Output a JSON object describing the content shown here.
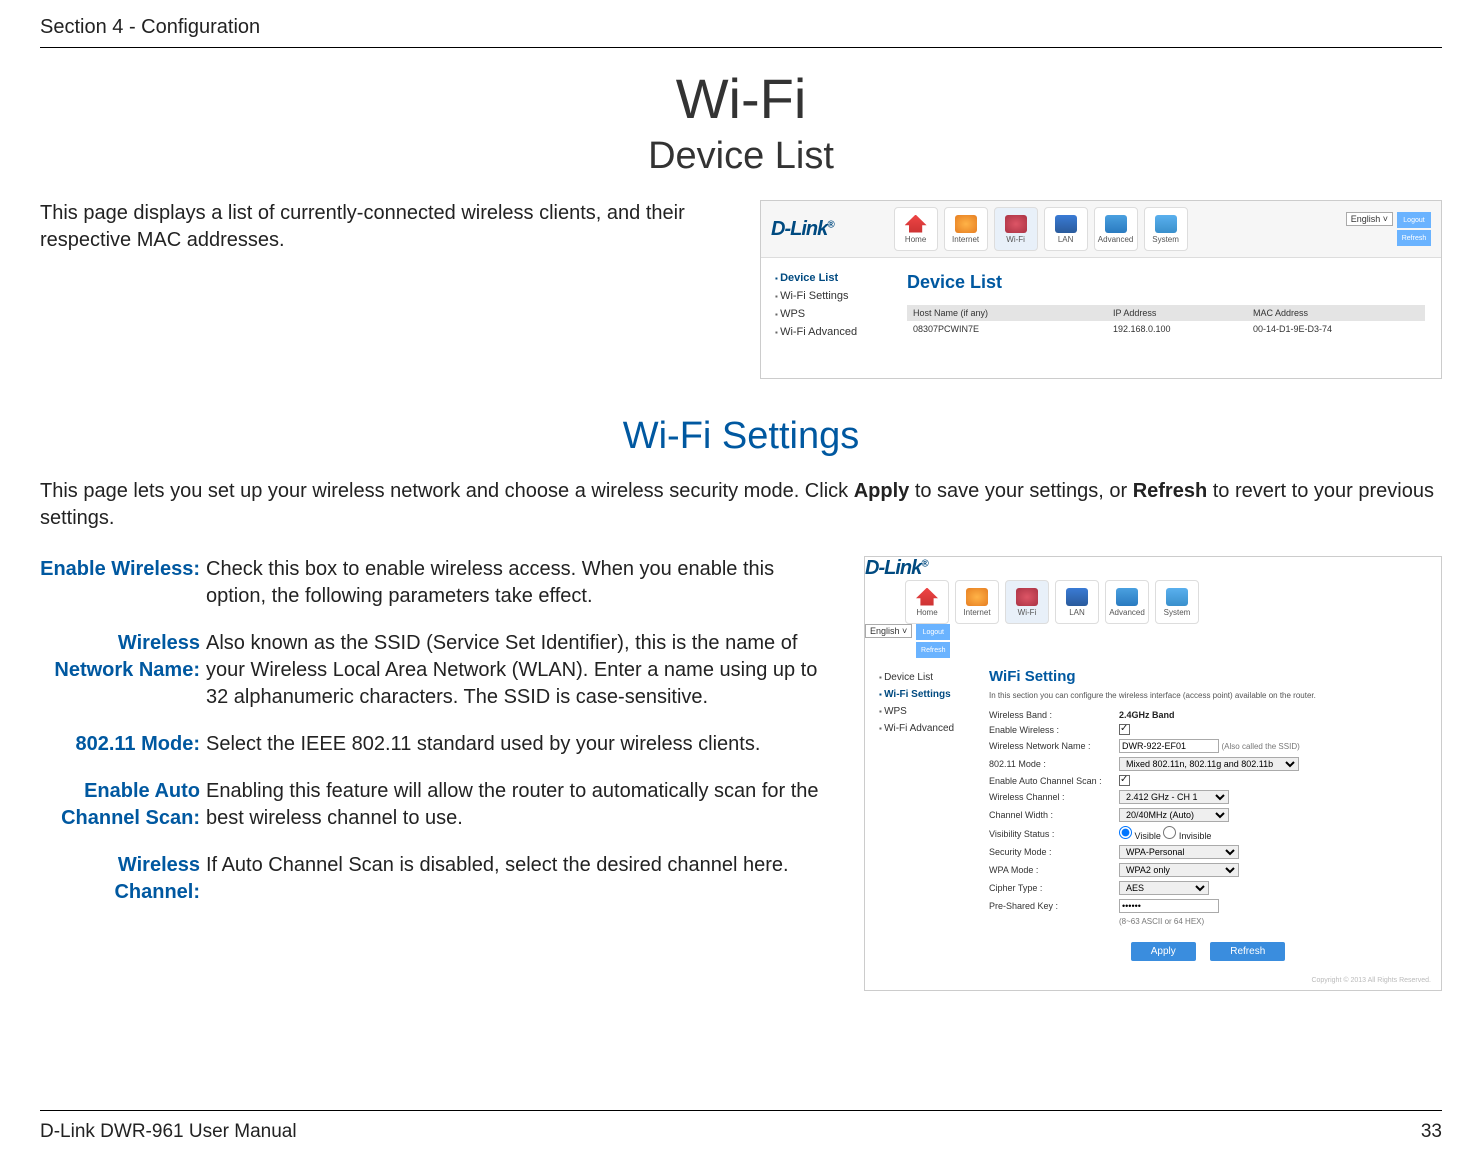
{
  "header": {
    "section_label": "Section 4 - Configuration"
  },
  "title": "Wi-Fi",
  "subtitle": "Device List",
  "intro1": "This page displays a list of currently-connected wireless clients, and their respective MAC addresses.",
  "shot1": {
    "logo": "D-Link",
    "nav": {
      "home": "Home",
      "internet": "Internet",
      "wifi": "Wi-Fi",
      "lan": "LAN",
      "advanced": "Advanced",
      "system": "System"
    },
    "lang": "English",
    "btn_logout": "Logout",
    "btn_refresh": "Refresh",
    "side": {
      "device_list": "Device List",
      "wifi_settings": "Wi-Fi Settings",
      "wps": "WPS",
      "wifi_advanced": "Wi-Fi Advanced"
    },
    "panel_title": "Device List",
    "table": {
      "c1": "Host Name (if any)",
      "c2": "IP Address",
      "c3": "MAC Address",
      "r1c1": "08307PCWIN7E",
      "r1c2": "192.168.0.100",
      "r1c3": "00-14-D1-9E-D3-74"
    }
  },
  "settings_title": "Wi-Fi Settings",
  "settings_intro_parts": {
    "p1": "This page lets you set up your wireless network and choose a wireless security mode. Click ",
    "b1": "Apply",
    "p2": " to save your settings, or ",
    "b2": "Refresh",
    "p3": " to revert to your previous settings."
  },
  "terms": {
    "t1": "Enable Wireless:",
    "d1": "Check this box to enable wireless access. When you enable this option, the following parameters take effect.",
    "t2": "Wireless Network Name:",
    "d2": "Also known as the SSID (Service Set Identifier), this is the name of your Wireless Local Area Network (WLAN). Enter a name using up to 32 alphanumeric characters. The SSID is case-sensitive.",
    "t3": "802.11 Mode:",
    "d3": "Select the IEEE 802.11 standard used by your wireless clients.",
    "t4": "Enable Auto Channel Scan:",
    "d4": "Enabling this feature will allow the router to automatically scan for the best wireless channel to use.",
    "t5": "Wireless Channel:",
    "d5": "If Auto Channel Scan is disabled, select the desired channel here."
  },
  "shot2": {
    "panel_title": "WiFi Setting",
    "sub_desc": "In this section you can configure the wireless interface (access point) available on the router.",
    "rows": {
      "band_l": "Wireless Band :",
      "band_v": "2.4GHz Band",
      "enable_l": "Enable Wireless :",
      "name_l": "Wireless Network Name :",
      "name_v": "DWR-922-EF01",
      "name_hint": "(Also called the SSID)",
      "mode_l": "802.11 Mode :",
      "mode_v": "Mixed 802.11n, 802.11g and 802.11b",
      "auto_l": "Enable Auto Channel Scan :",
      "chan_l": "Wireless Channel :",
      "chan_v": "2.412 GHz - CH 1",
      "width_l": "Channel Width :",
      "width_v": "20/40MHz (Auto)",
      "vis_l": "Visibility Status :",
      "vis_a": "Visible",
      "vis_b": "Invisible",
      "sec_l": "Security Mode :",
      "sec_v": "WPA-Personal",
      "wpa_l": "WPA Mode :",
      "wpa_v": "WPA2 only",
      "cipher_l": "Cipher Type :",
      "cipher_v": "AES",
      "psk_l": "Pre-Shared Key :",
      "psk_v": "••••••",
      "psk_hint": "(8~63 ASCII or 64 HEX)"
    },
    "btn_apply": "Apply",
    "btn_refresh": "Refresh",
    "copyright": "Copyright © 2013  All Rights Reserved."
  },
  "footer": {
    "left": "D-Link DWR-961 User Manual",
    "right": "33"
  }
}
